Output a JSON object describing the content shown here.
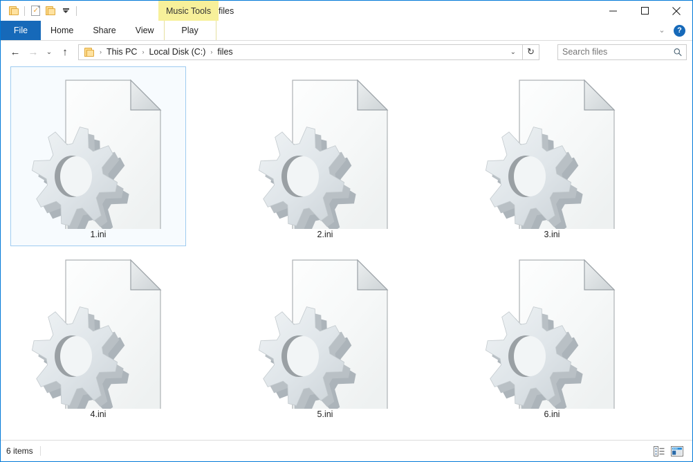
{
  "window": {
    "title": "files",
    "contextual_tab_group": "Music Tools",
    "caption": {
      "minimize": "minimize-button",
      "maximize": "maximize-button",
      "close": "close-button"
    }
  },
  "quick_access": {
    "items": [
      {
        "name": "folder-icon",
        "label": "Folder"
      },
      {
        "name": "properties-icon",
        "label": "Properties"
      },
      {
        "name": "new-folder-icon",
        "label": "New folder"
      },
      {
        "name": "customize-caret-icon",
        "label": "Customize Quick Access Toolbar"
      }
    ]
  },
  "ribbon": {
    "tabs": [
      {
        "label": "File",
        "active": true
      },
      {
        "label": "Home",
        "active": false
      },
      {
        "label": "Share",
        "active": false
      },
      {
        "label": "View",
        "active": false
      },
      {
        "label": "Play",
        "active": false
      }
    ],
    "collapse_label": "⌄",
    "help_label": "?"
  },
  "navigation": {
    "back_label": "←",
    "forward_label": "→",
    "recent_label": "⌄",
    "up_label": "↑"
  },
  "address": {
    "breadcrumbs": [
      "This PC",
      "Local Disk (C:)",
      "files"
    ],
    "separator": "›",
    "dropdown_label": "⌄",
    "refresh_label": "↻"
  },
  "search": {
    "placeholder": "Search files",
    "value": ""
  },
  "files": [
    {
      "name": "1.ini",
      "type": "ini-file",
      "selected": true
    },
    {
      "name": "2.ini",
      "type": "ini-file",
      "selected": false
    },
    {
      "name": "3.ini",
      "type": "ini-file",
      "selected": false
    },
    {
      "name": "4.ini",
      "type": "ini-file",
      "selected": false
    },
    {
      "name": "5.ini",
      "type": "ini-file",
      "selected": false
    },
    {
      "name": "6.ini",
      "type": "ini-file",
      "selected": false
    }
  ],
  "status": {
    "item_count": "6 items",
    "view_details_label": "Details view",
    "view_large_icons_label": "Large icons view"
  },
  "colors": {
    "window_border": "#0078d7",
    "file_tab": "#1669b9",
    "contextual_tab": "#f7f09a",
    "selection_border": "#9ecbf0",
    "selection_fill": "#f7fbfe",
    "gear_face": "#dfe5e9",
    "gear_side": "#a8b0b6",
    "page_border": "#adb2b5"
  }
}
